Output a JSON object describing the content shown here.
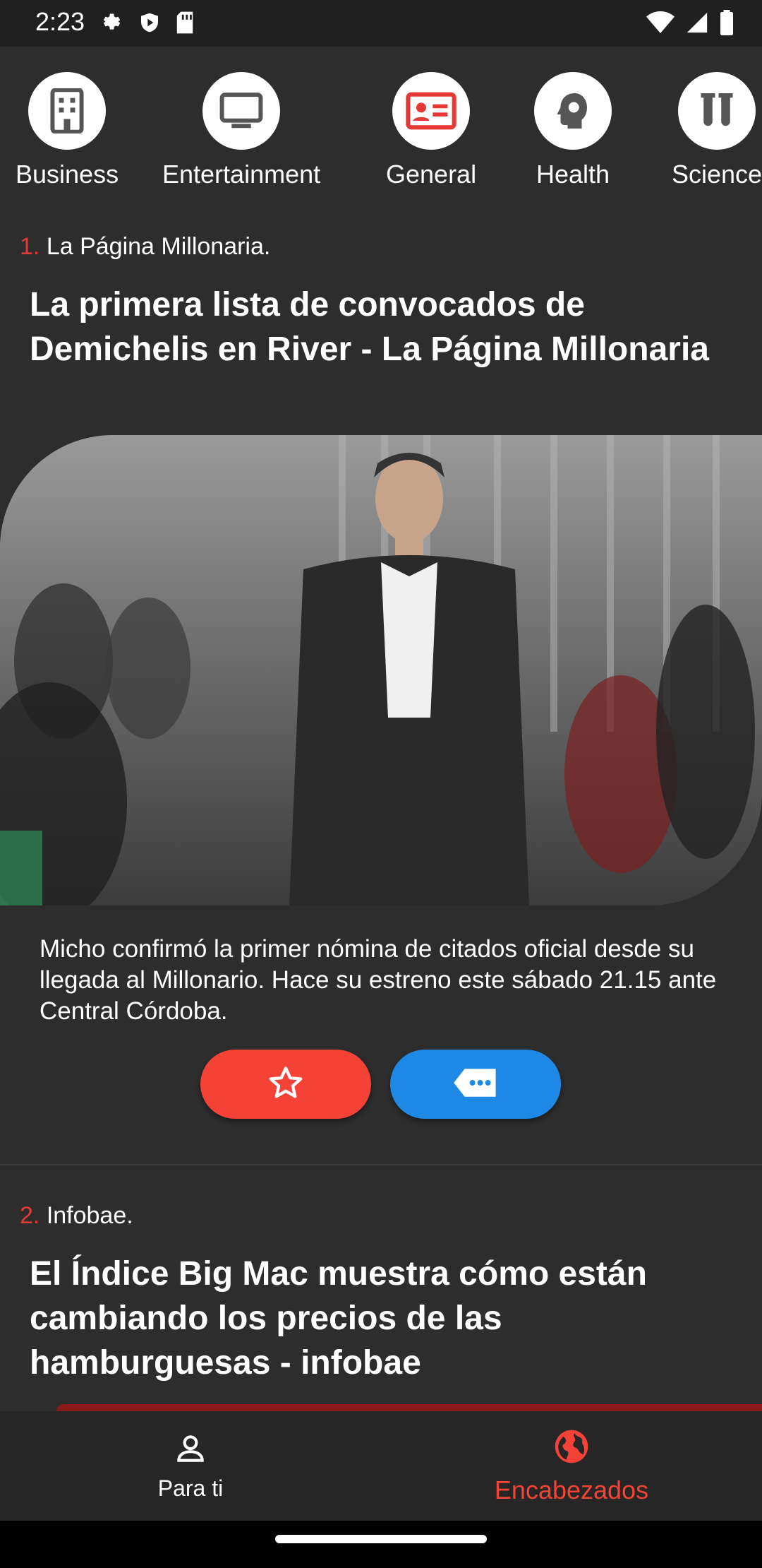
{
  "status_bar": {
    "time": "2:23",
    "icons_left": [
      "settings-icon",
      "shield-play-icon",
      "sd-card-icon"
    ],
    "icons_right": [
      "wifi-icon",
      "signal-icon",
      "battery-icon"
    ]
  },
  "categories": [
    {
      "label": "Business",
      "icon": "building-icon"
    },
    {
      "label": "Entertainment",
      "icon": "tv-icon"
    },
    {
      "label": "General",
      "icon": "contact-card-icon"
    },
    {
      "label": "Health",
      "icon": "head-gear-icon"
    },
    {
      "label": "Science",
      "icon": "test-tubes-icon"
    }
  ],
  "articles": [
    {
      "number": "1.",
      "source": "La Página Millonaria.",
      "title": "La primera lista de convocados de Demichelis en River - La Página Millonaria",
      "description": "Micho confirmó la primer nómina de citados oficial desde su llegada al Millonario. Hace su estreno este sábado 21.15 ante Central Córdoba."
    },
    {
      "number": "2.",
      "source": "Infobae.",
      "title": "El Índice Big Mac muestra cómo están cambiando los precios de las hamburguesas - infobae"
    }
  ],
  "bottom_nav": {
    "items": [
      {
        "label": "Para ti",
        "icon": "person-icon",
        "active": false
      },
      {
        "label": "Encabezados",
        "icon": "globe-icon",
        "active": true
      }
    ]
  },
  "colors": {
    "accent_red": "#f44336",
    "accent_blue": "#1e88e5",
    "background": "#2d2d2d"
  }
}
